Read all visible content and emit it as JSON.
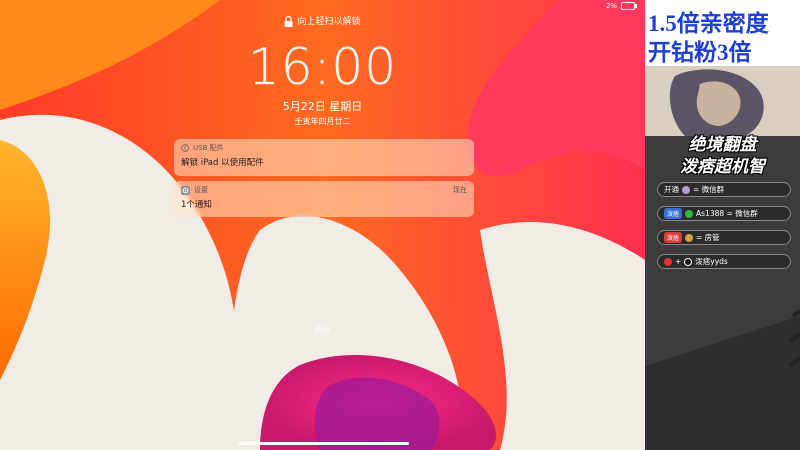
{
  "status": {
    "battery": "2%"
  },
  "lockscreen": {
    "swipe_hint": "向上轻扫以解锁",
    "time": "16:00",
    "date": "5月22日 星期日",
    "lunar": "壬寅年四月廿二",
    "cancel": "取消"
  },
  "notifications": [
    {
      "app": "USB 配件",
      "when": "",
      "body": "解锁 iPad 以使用配件",
      "icon": "warning-icon"
    },
    {
      "app": "设置",
      "when": "现在",
      "body": "1个通知",
      "icon": "settings-icon"
    }
  ],
  "sidebar": {
    "promo_line1": "1.5倍亲密度",
    "promo_line2": "开钻粉3倍",
    "banner_title1": "绝境翻盘",
    "banner_title2": "泼痞超机智",
    "rows": [
      {
        "a": "开通",
        "b": "= 微信群"
      },
      {
        "a": "泼痞",
        "b": "As1388 = 微信群"
      },
      {
        "a": "泼痞",
        "b": "= 房管"
      },
      {
        "a": "+",
        "b": "泼痞yyds"
      }
    ]
  },
  "colors": {
    "promo_text": "#1c3fd8",
    "wallpaper_orange": "#ff7a1a",
    "wallpaper_red": "#ff2d4a"
  }
}
